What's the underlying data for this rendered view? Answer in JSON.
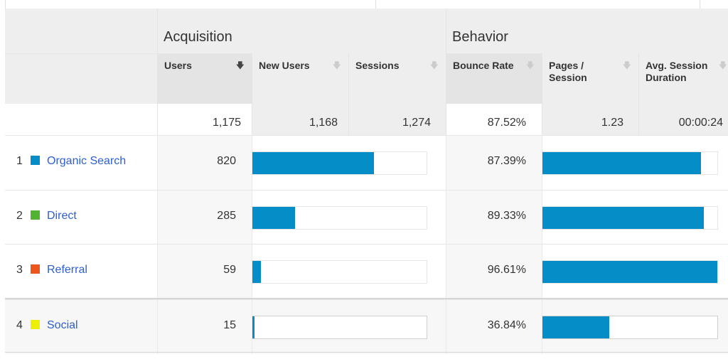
{
  "groups": {
    "acquisition": "Acquisition",
    "behavior": "Behavior"
  },
  "columns": [
    {
      "label": "Users",
      "sorted": true
    },
    {
      "label": "New Users",
      "sorted": false
    },
    {
      "label": "Sessions",
      "sorted": false
    },
    {
      "label": "Bounce Rate",
      "sorted": false
    },
    {
      "label": "Pages / Session",
      "sorted": false
    },
    {
      "label": "Avg. Session Duration",
      "sorted": false
    }
  ],
  "sort_icon": "sort-down-arrow-icon",
  "totals": {
    "users": "1,175",
    "new_users": "1,168",
    "sessions": "1,274",
    "bounce_rate": "87.52%",
    "pages_per_session": "1.23",
    "avg_session_duration": "00:00:24"
  },
  "rows": [
    {
      "index": "1",
      "channel": "Organic Search",
      "color": "#058dc7",
      "users": "820",
      "users_share": 0.698,
      "bounce_rate": "87.39%",
      "bounce_value": 87.39
    },
    {
      "index": "2",
      "channel": "Direct",
      "color": "#50b432",
      "users": "285",
      "users_share": 0.243,
      "bounce_rate": "89.33%",
      "bounce_value": 89.33
    },
    {
      "index": "3",
      "channel": "Referral",
      "color": "#ed561b",
      "users": "59",
      "users_share": 0.05,
      "bounce_rate": "96.61%",
      "bounce_value": 96.61
    },
    {
      "index": "4",
      "channel": "Social",
      "color": "#edef00",
      "users": "15",
      "users_share": 0.013,
      "bounce_rate": "36.84%",
      "bounce_value": 36.84
    }
  ],
  "bounce_bar_max": 96.61
}
